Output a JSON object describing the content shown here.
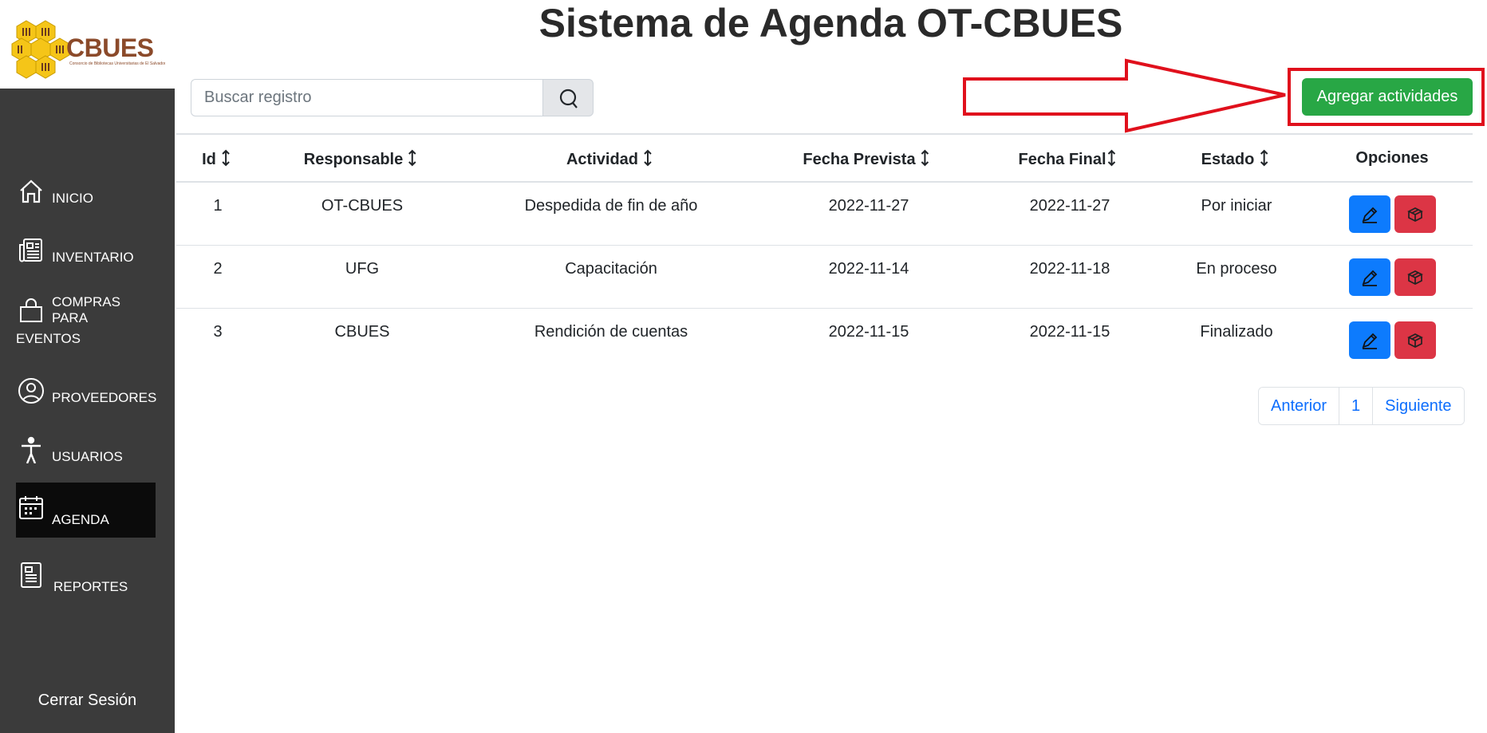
{
  "brand": {
    "name": "CBUES",
    "subtitle": "Consorcio de Bibliotecas Universitarias de El Salvador",
    "color": "#8b4a2a"
  },
  "page_title": "Sistema de Agenda OT-CBUES",
  "search": {
    "placeholder": "Buscar registro"
  },
  "add_button": "Agregar actividades",
  "sidebar": {
    "items": [
      {
        "label": "INICIO",
        "icon": "home-icon"
      },
      {
        "label": "INVENTARIO",
        "icon": "newspaper-icon"
      },
      {
        "label": "COMPRAS PARA",
        "label2": "EVENTOS",
        "icon": "shopping-bag-icon"
      },
      {
        "label": "PROVEEDORES",
        "icon": "user-circle-icon"
      },
      {
        "label": "USUARIOS",
        "icon": "person-icon"
      },
      {
        "label": "AGENDA",
        "icon": "calendar-icon",
        "active": true
      },
      {
        "label": "REPORTES",
        "icon": "report-icon"
      }
    ],
    "logout": "Cerrar Sesión"
  },
  "table": {
    "headers": [
      "Id",
      "Responsable",
      "Actividad",
      "Fecha Prevista",
      "Fecha Final",
      "Estado",
      "Opciones"
    ],
    "rows": [
      {
        "id": "1",
        "responsable": "OT-CBUES",
        "actividad": "Despedida de fin de año",
        "fecha_prevista": "2022-11-27",
        "fecha_final": "2022-11-27",
        "estado": "Por iniciar"
      },
      {
        "id": "2",
        "responsable": "UFG",
        "actividad": "Capacitación",
        "fecha_prevista": "2022-11-14",
        "fecha_final": "2022-11-18",
        "estado": "En proceso"
      },
      {
        "id": "3",
        "responsable": "CBUES",
        "actividad": "Rendición de cuentas",
        "fecha_prevista": "2022-11-15",
        "fecha_final": "2022-11-15",
        "estado": "Finalizado"
      }
    ]
  },
  "pagination": {
    "prev": "Anterior",
    "current": "1",
    "next": "Siguiente"
  },
  "colors": {
    "sidebar": "#3b3b3b",
    "active": "#0b0b0b",
    "success": "#28a745",
    "primary": "#0d7bfd",
    "danger": "#dc3545",
    "annotation": "#e0101c"
  }
}
